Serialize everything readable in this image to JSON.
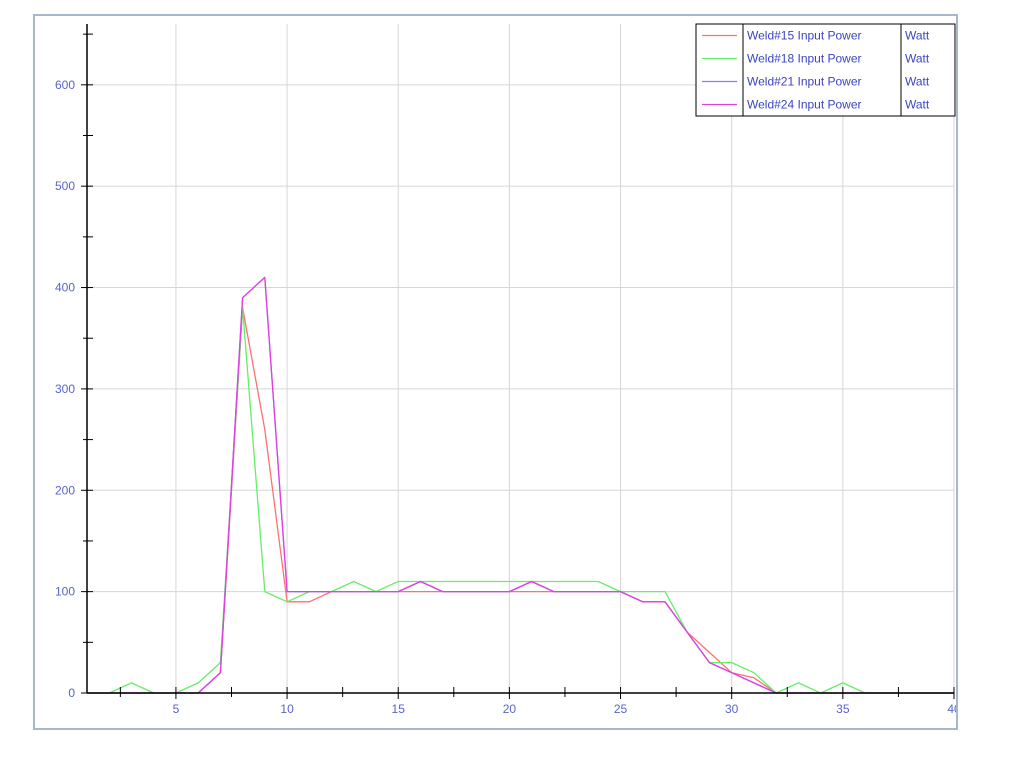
{
  "chart_data": {
    "type": "line",
    "title": "",
    "xlabel": "",
    "ylabel": "",
    "xlim": [
      1,
      40
    ],
    "ylim": [
      0,
      660
    ],
    "x_ticks": [
      5,
      10,
      15,
      20,
      25,
      30,
      35,
      40
    ],
    "y_ticks": [
      0,
      100,
      200,
      300,
      400,
      500,
      600
    ],
    "grid": true,
    "legend_position": "top-right",
    "x": [
      1,
      2,
      3,
      4,
      5,
      6,
      7,
      8,
      9,
      10,
      11,
      12,
      13,
      14,
      15,
      16,
      17,
      18,
      19,
      20,
      21,
      22,
      23,
      24,
      25,
      26,
      27,
      28,
      29,
      30,
      31,
      32,
      33,
      34,
      35,
      36,
      37,
      38,
      39,
      40
    ],
    "series": [
      {
        "name": "Weld#15 Input Power",
        "unit": "Watt",
        "color": "#ff7070",
        "values": [
          0,
          0,
          0,
          0,
          0,
          0,
          20,
          380,
          260,
          90,
          90,
          100,
          100,
          100,
          100,
          100,
          100,
          100,
          100,
          100,
          100,
          100,
          100,
          100,
          100,
          90,
          90,
          60,
          40,
          20,
          15,
          0,
          0,
          0,
          0,
          0,
          0,
          0,
          0,
          0
        ]
      },
      {
        "name": "Weld#18 Input Power",
        "unit": "Watt",
        "color": "#66ee66",
        "values": [
          0,
          0,
          10,
          0,
          0,
          10,
          30,
          380,
          100,
          90,
          100,
          100,
          110,
          100,
          110,
          110,
          110,
          110,
          110,
          110,
          110,
          110,
          110,
          110,
          100,
          100,
          100,
          60,
          30,
          30,
          20,
          0,
          10,
          0,
          10,
          0,
          0,
          0,
          0,
          0
        ]
      },
      {
        "name": "Weld#21 Input Power",
        "unit": "Watt",
        "color": "#8080ff",
        "values": [
          0,
          0,
          0,
          0,
          0,
          0,
          20,
          390,
          410,
          100,
          100,
          100,
          100,
          100,
          100,
          110,
          100,
          100,
          100,
          100,
          110,
          100,
          100,
          100,
          100,
          90,
          90,
          60,
          30,
          20,
          10,
          0,
          0,
          0,
          0,
          0,
          0,
          0,
          0,
          0
        ]
      },
      {
        "name": "Weld#24 Input Power",
        "unit": "Watt",
        "color": "#e040e0",
        "values": [
          0,
          0,
          0,
          0,
          0,
          0,
          20,
          390,
          410,
          100,
          100,
          100,
          100,
          100,
          100,
          110,
          100,
          100,
          100,
          100,
          110,
          100,
          100,
          100,
          100,
          90,
          90,
          60,
          30,
          20,
          10,
          0,
          0,
          0,
          0,
          0,
          0,
          0,
          0,
          0
        ]
      }
    ]
  },
  "colors": {
    "grid": "#d6d6d6",
    "axis": "#000000",
    "tick_label": "#5b63c9",
    "legend_text": "#3b44c0",
    "frame_border": "#a8b8cc"
  }
}
